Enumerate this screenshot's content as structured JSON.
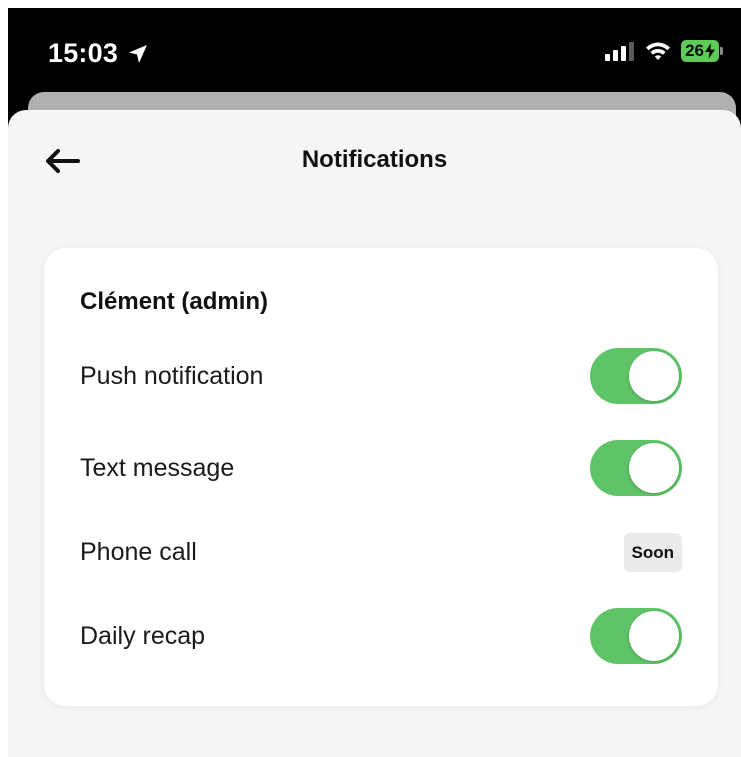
{
  "status_bar": {
    "time": "15:03",
    "battery_level": "26",
    "icons": [
      "location-arrow-icon",
      "cellular-signal-icon",
      "wifi-icon",
      "battery-charging-icon"
    ],
    "battery_color": "#5ecb57"
  },
  "header": {
    "title": "Notifications",
    "back_icon": "arrow-left-icon"
  },
  "card": {
    "title": "Clément (admin)",
    "rows": [
      {
        "label": "Push notification",
        "control": "toggle",
        "on": true
      },
      {
        "label": "Text message",
        "control": "toggle",
        "on": true
      },
      {
        "label": "Phone call",
        "control": "badge",
        "badge": "Soon"
      },
      {
        "label": "Daily recap",
        "control": "toggle",
        "on": true
      }
    ]
  },
  "colors": {
    "toggle_on": "#5ec467",
    "background": "#f5f5f5",
    "card": "#ffffff"
  }
}
